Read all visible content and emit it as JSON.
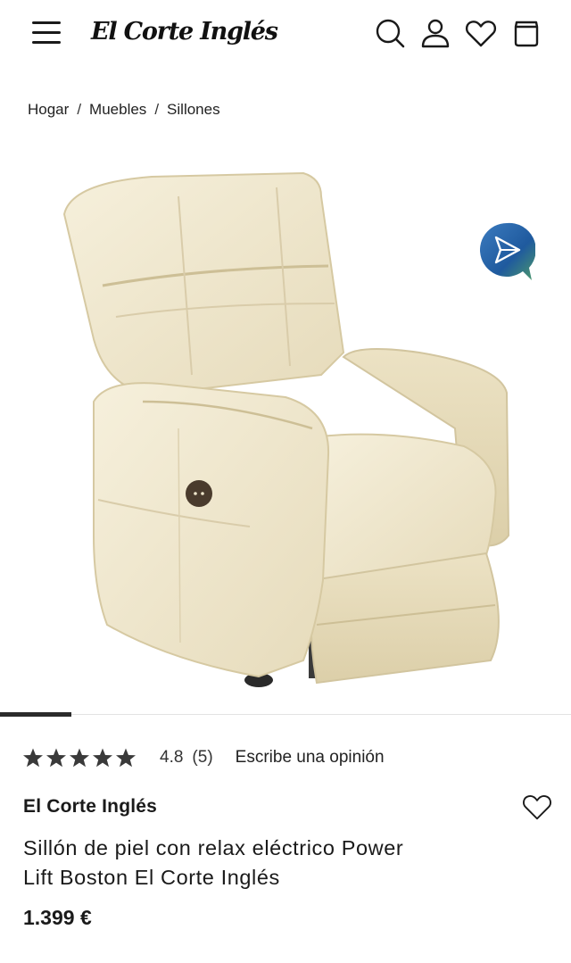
{
  "header": {
    "logo_text": "El Corte Inglés",
    "icons": [
      "menu-icon",
      "search-icon",
      "user-icon",
      "heart-icon",
      "bag-icon"
    ]
  },
  "breadcrumb": {
    "items": [
      "Hogar",
      "Muebles",
      "Sillones"
    ],
    "separator": "/"
  },
  "gallery": {
    "image_subject": "recliner-armchair-cream-leather",
    "active_index": 1,
    "share_icon": "share-bubble-icon"
  },
  "rating": {
    "stars": 5,
    "score": "4.8",
    "count": "(5)",
    "write_review": "Escribe una opinión"
  },
  "product": {
    "brand": "El Corte Inglés",
    "title_line1": "Sillón de piel con relax eléctrico Power",
    "title_line2": "Lift Boston El Corte Inglés",
    "price": "1.399 €"
  },
  "colors": {
    "text": "#1a1a1a",
    "share_blue": "#1f5a9e",
    "share_green": "#4c9a6a",
    "chair": "#efe6cc"
  }
}
